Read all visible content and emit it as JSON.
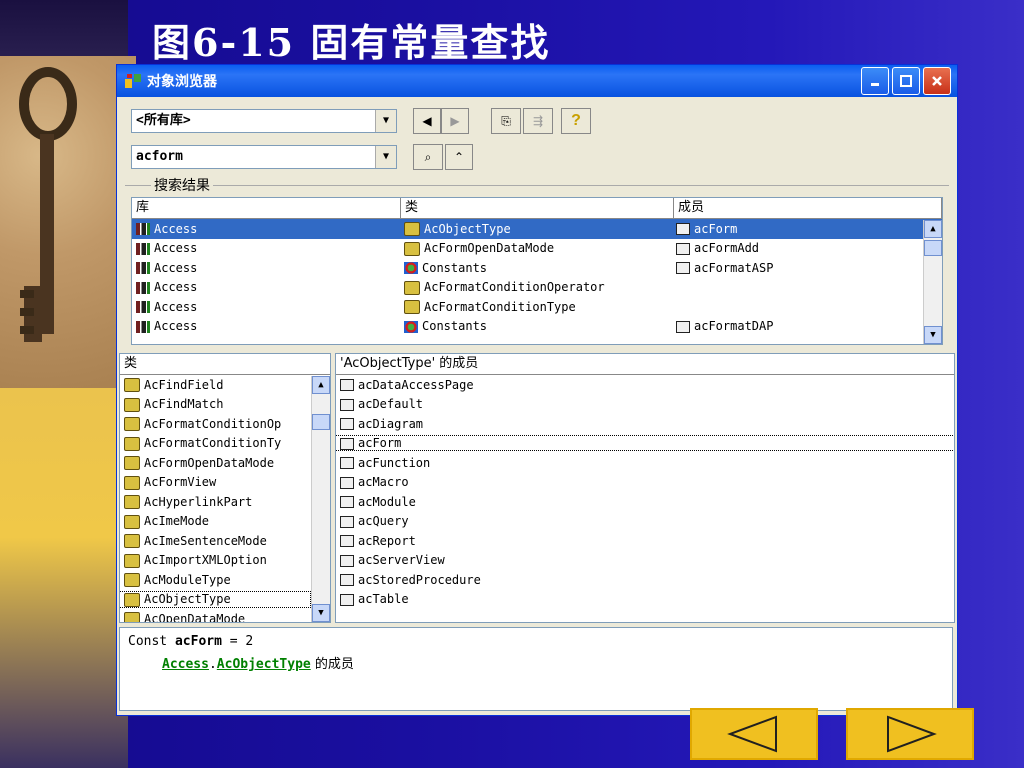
{
  "slide": {
    "title": "图6-15   固有常量查找"
  },
  "window": {
    "title": "对象浏览器",
    "library_combo": "<所有库>",
    "search_combo": "acform",
    "search_group_label": "搜索结果"
  },
  "results": {
    "headers": [
      "库",
      "类",
      "成员"
    ],
    "rows": [
      {
        "lib": "Access",
        "cls": "AcObjectType",
        "cls_icon": "enum",
        "member": "acForm",
        "selected": true
      },
      {
        "lib": "Access",
        "cls": "AcFormOpenDataMode",
        "cls_icon": "enum",
        "member": "acFormAdd"
      },
      {
        "lib": "Access",
        "cls": "Constants",
        "cls_icon": "class",
        "member": "acFormatASP"
      },
      {
        "lib": "Access",
        "cls": "AcFormatConditionOperator",
        "cls_icon": "enum",
        "member": ""
      },
      {
        "lib": "Access",
        "cls": "AcFormatConditionType",
        "cls_icon": "enum",
        "member": ""
      },
      {
        "lib": "Access",
        "cls": "Constants",
        "cls_icon": "class",
        "member": "acFormatDAP"
      }
    ]
  },
  "classes": {
    "header": "类",
    "items": [
      "AcFindField",
      "AcFindMatch",
      "AcFormatConditionOp",
      "AcFormatConditionTy",
      "AcFormOpenDataMode",
      "AcFormView",
      "AcHyperlinkPart",
      "AcImeMode",
      "AcImeSentenceMode",
      "AcImportXMLOption",
      "AcModuleType",
      "AcObjectType",
      "AcOpenDataMode"
    ],
    "selected_index": 11
  },
  "members": {
    "header": "'AcObjectType' 的成员",
    "items": [
      "acDataAccessPage",
      "acDefault",
      "acDiagram",
      "acForm",
      "acFunction",
      "acMacro",
      "acModule",
      "acQuery",
      "acReport",
      "acServerView",
      "acStoredProcedure",
      "acTable"
    ],
    "selected_index": 3
  },
  "details": {
    "const_prefix": "Const ",
    "const_name": "acForm",
    "const_suffix": " = 2",
    "link_lib": "Access",
    "link_sep": ".",
    "link_cls": "AcObjectType",
    "link_suffix": " 的成员"
  },
  "nav": {
    "prev": "previous-slide",
    "next": "next-slide"
  }
}
